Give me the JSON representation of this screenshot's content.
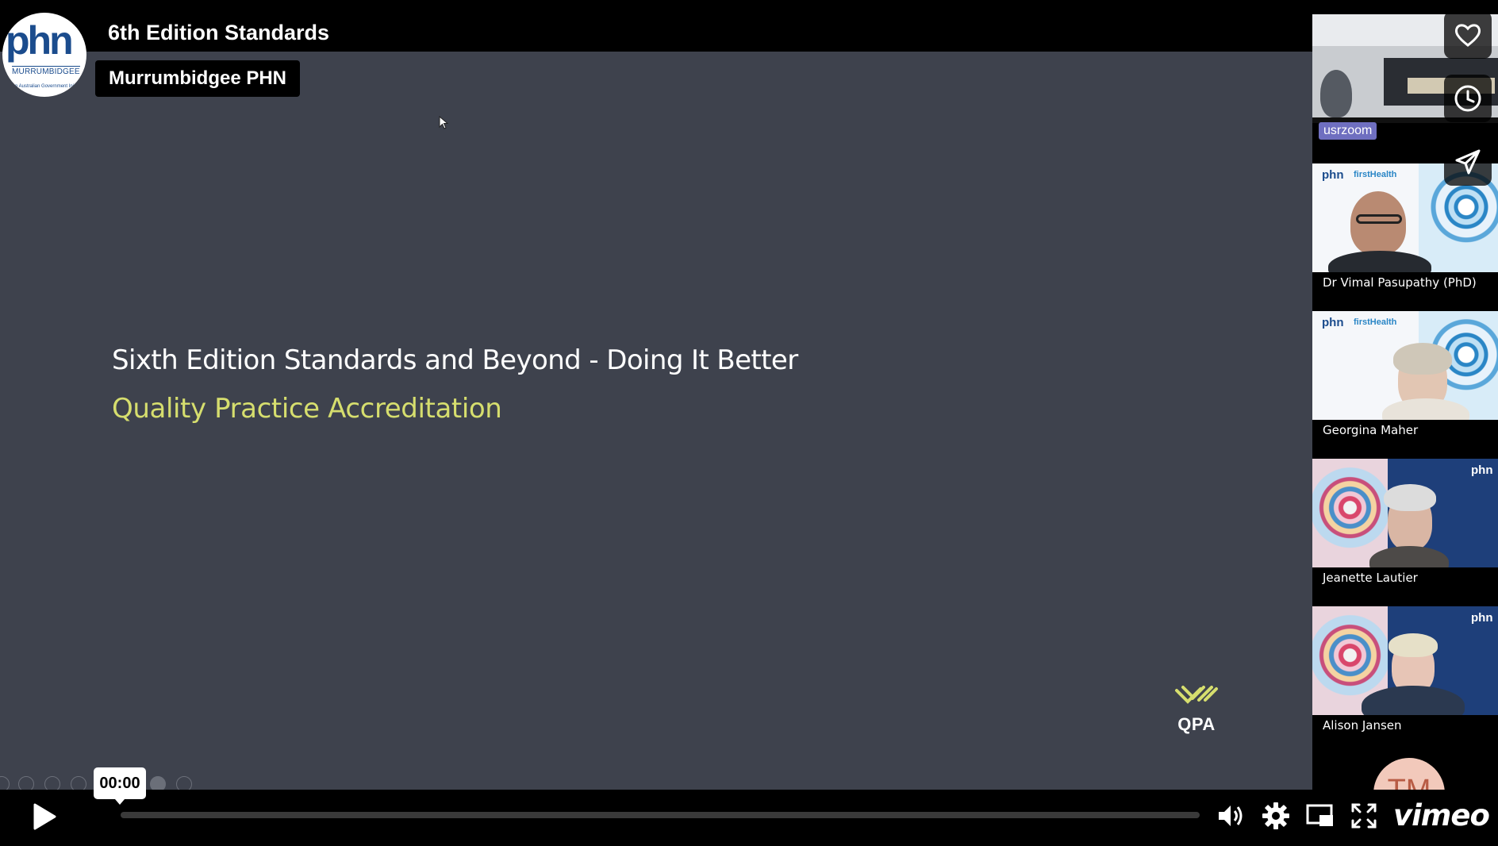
{
  "video": {
    "title": "6th Edition Standards",
    "byline": "Murrumbidgee PHN",
    "channel_logo": {
      "text": "phn",
      "subtext": "MURRUMBIDGEE",
      "fine_print": "An Australian Government Initiative"
    }
  },
  "slide": {
    "title": "Sixth Edition Standards and Beyond - Doing It Better",
    "subtitle": "Quality Practice Accreditation",
    "logo_text": "QPA",
    "bg_color": "#3e424d",
    "subtitle_color": "#d6de6e"
  },
  "participants": [
    {
      "name": "usrzoom",
      "badge": true
    },
    {
      "name": "Dr Vimal Pasupathy (PhD)"
    },
    {
      "name": "Georgina Maher"
    },
    {
      "name": "Jeanette Lautier"
    },
    {
      "name": "Alison Jansen"
    },
    {
      "name": "TM",
      "initials": true
    }
  ],
  "side_actions": [
    {
      "name": "like",
      "icon": "heart-icon"
    },
    {
      "name": "watch-later",
      "icon": "clock-icon"
    },
    {
      "name": "share",
      "icon": "paper-plane-icon"
    }
  ],
  "player": {
    "current_time": "00:00",
    "progress": 0,
    "brand": "vimeo",
    "controls": [
      "play-icon",
      "volume-icon",
      "settings-icon",
      "pip-icon",
      "fullscreen-icon"
    ]
  }
}
